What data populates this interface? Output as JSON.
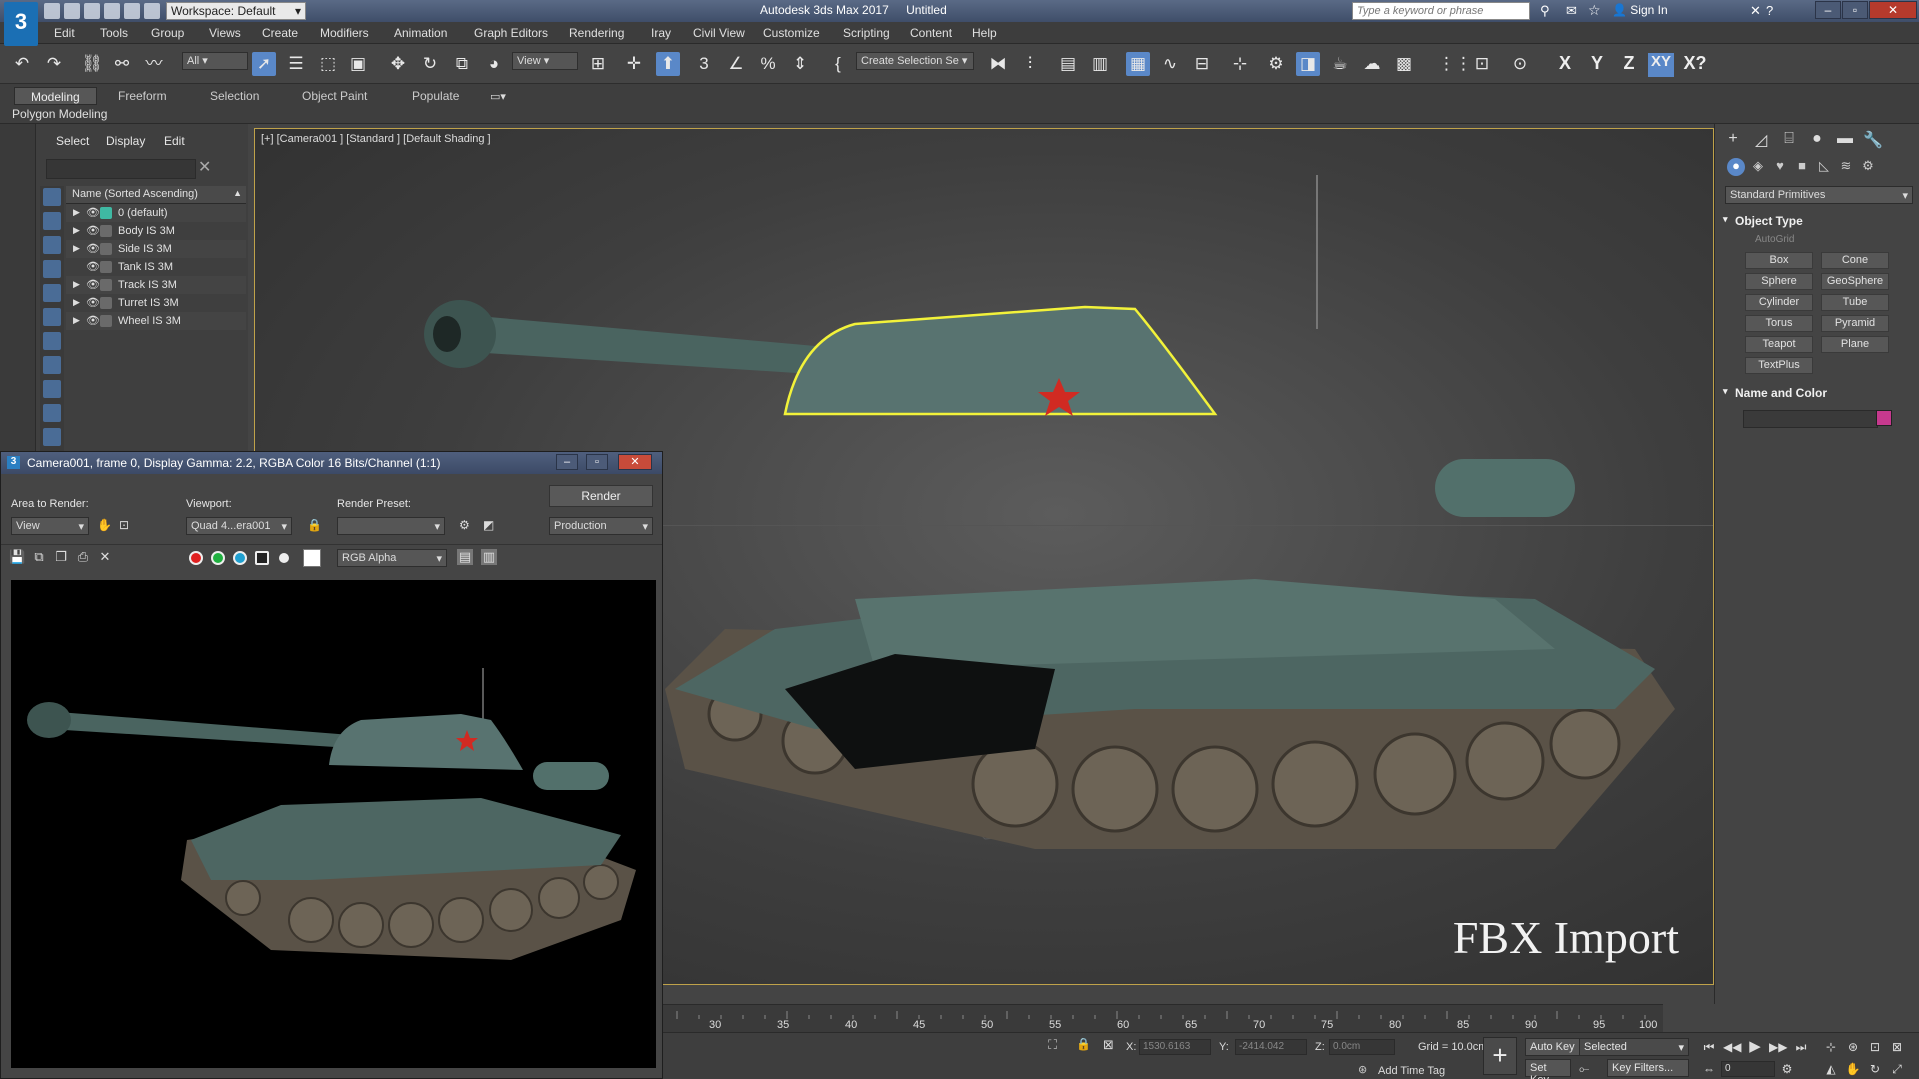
{
  "titlebar": {
    "logo": "3",
    "workspace_label": "Workspace: Default",
    "app_name": "Autodesk 3ds Max 2017",
    "doc_name": "Untitled",
    "search_placeholder": "Type a keyword or phrase",
    "sign_in": "Sign In"
  },
  "menu": [
    "Edit",
    "Tools",
    "Group",
    "Views",
    "Create",
    "Modifiers",
    "Animation",
    "Graph Editors",
    "Rendering",
    "Iray",
    "Civil View",
    "Customize",
    "Scripting",
    "Content",
    "Help"
  ],
  "toolbar": {
    "selection_filter": "All",
    "ref_coord": "View",
    "create_selection_set": "Create Selection Se",
    "axes": [
      "X",
      "Y",
      "Z",
      "XY",
      "X?"
    ]
  },
  "ribbon": {
    "tabs": [
      "Modeling",
      "Freeform",
      "Selection",
      "Object Paint",
      "Populate"
    ],
    "active_tab": "Modeling",
    "panel_label": "Polygon Modeling"
  },
  "explorer": {
    "menu": [
      "Select",
      "Display",
      "Edit"
    ],
    "column_header": "Name (Sorted Ascending)",
    "rows": [
      {
        "label": "0 (default)",
        "expandable": true,
        "layer": true
      },
      {
        "label": "Body IS 3M",
        "expandable": true,
        "layer": false
      },
      {
        "label": "Side IS 3M",
        "expandable": true,
        "layer": false
      },
      {
        "label": "Tank IS 3M",
        "expandable": false,
        "layer": false
      },
      {
        "label": "Track IS 3M",
        "expandable": true,
        "layer": false
      },
      {
        "label": "Turret IS 3M",
        "expandable": true,
        "layer": false
      },
      {
        "label": "Wheel IS 3M",
        "expandable": true,
        "layer": false
      }
    ]
  },
  "viewport": {
    "label": "[+] [Camera001 ] [Standard ] [Default Shading ]",
    "overlay_text": "FBX Import",
    "selection_color": "#f2f23a",
    "tank_color": "#4f6b66",
    "star_color": "#d12a22"
  },
  "command_panel": {
    "dropdown": "Standard Primitives",
    "object_type_header": "Object Type",
    "autogrid": "AutoGrid",
    "primitives": [
      "Box",
      "Cone",
      "Sphere",
      "GeoSphere",
      "Cylinder",
      "Tube",
      "Torus",
      "Pyramid",
      "Teapot",
      "Plane",
      "TextPlus"
    ],
    "name_color_header": "Name and Color",
    "swatch_color": "#c6398e"
  },
  "render_window": {
    "title": "Camera001, frame 0, Display Gamma: 2.2, RGBA Color 16 Bits/Channel (1:1)",
    "area_label": "Area to Render:",
    "area_value": "View",
    "viewport_label": "Viewport:",
    "viewport_value": "Quad 4...era001",
    "preset_label": "Render Preset:",
    "preset_value": "",
    "render_button": "Render",
    "production_value": "Production",
    "channel_value": "RGB Alpha"
  },
  "timeline": {
    "ticks": [
      "30",
      "35",
      "40",
      "45",
      "50",
      "55",
      "60",
      "65",
      "70",
      "75",
      "80",
      "85",
      "90",
      "95",
      "100"
    ]
  },
  "status": {
    "x_label": "X:",
    "x_value": "1530.6163",
    "y_label": "Y:",
    "y_value": "-2414.042",
    "z_label": "Z:",
    "z_value": "0.0cm",
    "grid": "Grid = 10.0cm",
    "add_time_tag": "Add Time Tag",
    "auto_key": "Auto Key",
    "set_key": "Set Key",
    "selected_value": "Selected",
    "key_filters": "Key Filters...",
    "frame_value": "0"
  }
}
